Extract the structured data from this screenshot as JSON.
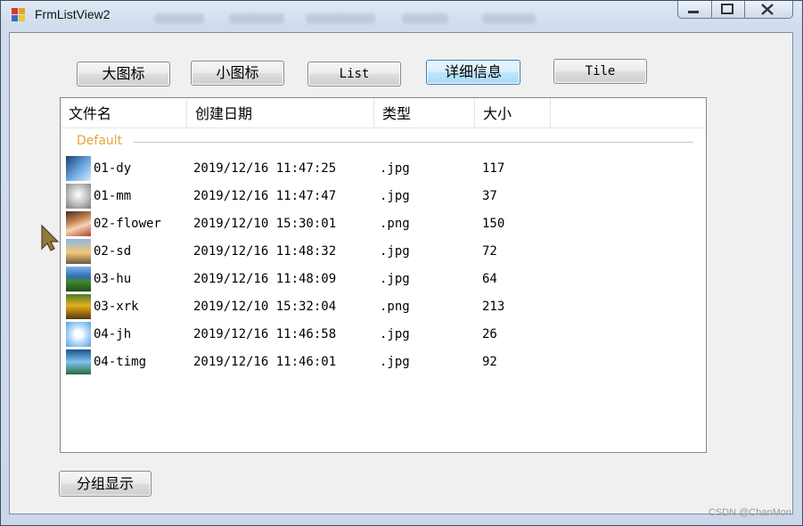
{
  "window": {
    "title": "FrmListView2"
  },
  "toolbar": {
    "large_icon": "大图标",
    "small_icon": "小图标",
    "list": "List",
    "details": "详细信息",
    "tile": "Tile"
  },
  "listview": {
    "columns": [
      "文件名",
      "创建日期",
      "类型",
      "大小"
    ],
    "group": "Default",
    "rows": [
      {
        "name": "01-dy",
        "date": "2019/12/16 11:47:25",
        "type": ".jpg",
        "size": "117",
        "thumb": "sky"
      },
      {
        "name": "01-mm",
        "date": "2019/12/16 11:47:47",
        "type": ".jpg",
        "size": "37",
        "thumb": "grey"
      },
      {
        "name": "02-flower",
        "date": "2019/12/10 15:30:01",
        "type": ".png",
        "size": "150",
        "thumb": "portrait"
      },
      {
        "name": "02-sd",
        "date": "2019/12/16 11:48:32",
        "type": ".jpg",
        "size": "72",
        "thumb": "sunset"
      },
      {
        "name": "03-hu",
        "date": "2019/12/16 11:48:09",
        "type": ".jpg",
        "size": "64",
        "thumb": "field"
      },
      {
        "name": "03-xrk",
        "date": "2019/12/10 15:32:04",
        "type": ".png",
        "size": "213",
        "thumb": "sunflower"
      },
      {
        "name": "04-jh",
        "date": "2019/12/16 11:46:58",
        "type": ".jpg",
        "size": "26",
        "thumb": "daisy"
      },
      {
        "name": "04-timg",
        "date": "2019/12/16 11:46:01",
        "type": ".jpg",
        "size": "92",
        "thumb": "ocean"
      }
    ]
  },
  "group_button": "分组显示",
  "watermark": "CSDN @ChanMon",
  "colors": {
    "group_label": "#e8a53a",
    "active_button": "#bee6fd"
  }
}
